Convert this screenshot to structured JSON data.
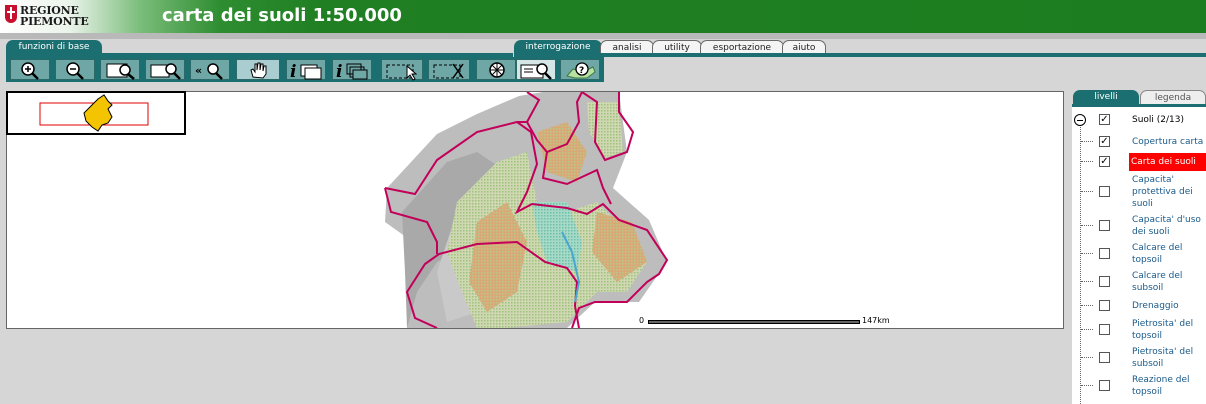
{
  "header": {
    "logo_line1": "REGIONE",
    "logo_line2": "PIEMONTE",
    "title": "carta dei suoli 1:50.000"
  },
  "tabs_left": [
    {
      "label": "funzioni di base",
      "active": true
    }
  ],
  "tabs_right": [
    {
      "label": "interrogazione",
      "active": true
    },
    {
      "label": "analisi",
      "active": false
    },
    {
      "label": "utility",
      "active": false
    },
    {
      "label": "esportazione",
      "active": false
    },
    {
      "label": "aiuto",
      "active": false
    }
  ],
  "toolbar": [
    {
      "icon": "zoom-in-icon",
      "selected": false
    },
    {
      "icon": "zoom-out-icon",
      "selected": false
    },
    {
      "icon": "zoom-full-extent-icon",
      "selected": false
    },
    {
      "icon": "zoom-layer-icon",
      "selected": false
    },
    {
      "icon": "zoom-previous-icon",
      "selected": false
    },
    {
      "icon": "pan-hand-icon",
      "selected": true
    },
    {
      "icon": "info-icon",
      "selected": false
    },
    {
      "icon": "info-multiple-icon",
      "selected": false
    },
    {
      "icon": "select-arrow-icon",
      "selected": false
    },
    {
      "icon": "clear-selection-icon",
      "selected": false
    },
    {
      "icon": "measure-wheel-icon",
      "selected": false
    },
    {
      "icon": "query-zoom-icon",
      "selected": false
    },
    {
      "icon": "query-help-icon",
      "selected": false
    }
  ],
  "scalebar": {
    "min": "0",
    "max": "147km"
  },
  "panel": {
    "tab_active": "livelli",
    "tab_inactive": "legenda",
    "root": {
      "label": "Suoli (2/13)",
      "checked": true
    },
    "layers": [
      {
        "label": "Copertura carta",
        "checked": true,
        "highlighted": false
      },
      {
        "label": "Carta dei suoli",
        "checked": true,
        "highlighted": true
      },
      {
        "label": "Capacita' protettiva dei suoli",
        "checked": false,
        "highlighted": false
      },
      {
        "label": "Capacita' d'uso dei suoli",
        "checked": false,
        "highlighted": false
      },
      {
        "label": "Calcare del topsoil",
        "checked": false,
        "highlighted": false
      },
      {
        "label": "Calcare del subsoil",
        "checked": false,
        "highlighted": false
      },
      {
        "label": "Drenaggio",
        "checked": false,
        "highlighted": false
      },
      {
        "label": "Pietrosita' del topsoil",
        "checked": false,
        "highlighted": false
      },
      {
        "label": "Pietrosita' del subsoil",
        "checked": false,
        "highlighted": false
      },
      {
        "label": "Reazione del topsoil",
        "checked": false,
        "highlighted": false
      }
    ]
  },
  "colors": {
    "header_green": "#1c7d20",
    "tab_teal": "#1b6f70",
    "boundary_magenta": "#c2005a",
    "highlight_red": "#ff0000"
  }
}
